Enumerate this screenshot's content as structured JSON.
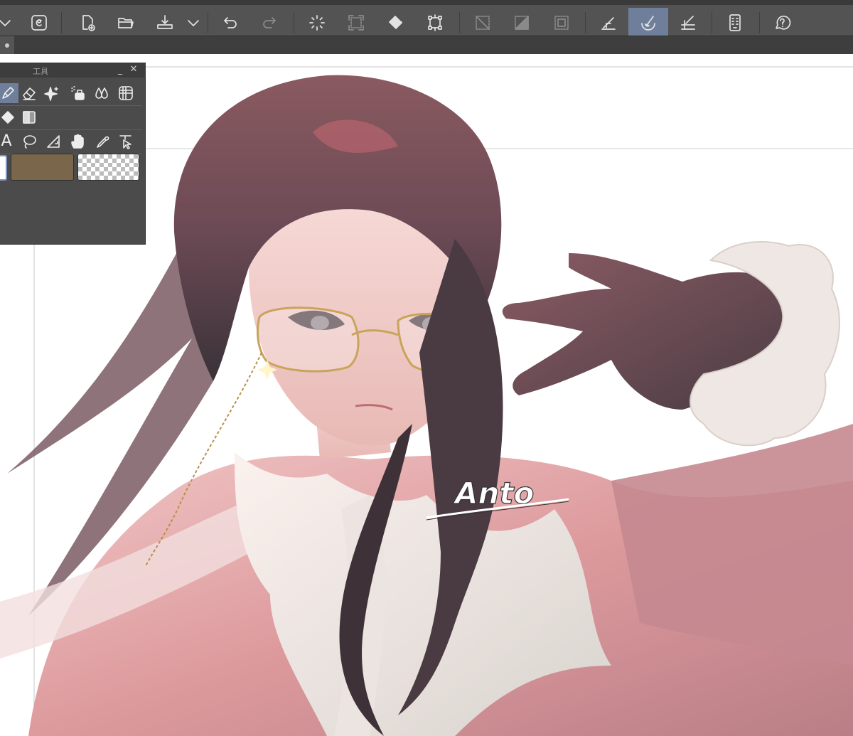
{
  "toolbar": {
    "buttons": [
      {
        "name": "menu-dropdown",
        "icon": "chevron-down-icon"
      },
      {
        "name": "app-menu",
        "icon": "clip-studio-icon"
      },
      {
        "name": "new-canvas",
        "icon": "new-document-icon"
      },
      {
        "name": "open-file",
        "icon": "folder-icon"
      },
      {
        "name": "save-file",
        "icon": "save-icon"
      },
      {
        "name": "save-options",
        "icon": "chevron-down-icon"
      },
      {
        "name": "undo",
        "icon": "undo-icon"
      },
      {
        "name": "redo",
        "icon": "redo-icon"
      },
      {
        "name": "loading-indicator",
        "icon": "spinner-icon"
      },
      {
        "name": "transform",
        "icon": "transform-icon"
      },
      {
        "name": "fill",
        "icon": "paint-bucket-icon"
      },
      {
        "name": "free-transform",
        "icon": "bounding-box-icon"
      },
      {
        "name": "clear-selection",
        "icon": "clear-selection-icon"
      },
      {
        "name": "invert-selection",
        "icon": "invert-selection-icon"
      },
      {
        "name": "show-selection",
        "icon": "selection-border-icon"
      },
      {
        "name": "snap-ruler",
        "icon": "snap-ruler-icon"
      },
      {
        "name": "snap-special-ruler",
        "icon": "brush-snap-icon"
      },
      {
        "name": "snap-grid",
        "icon": "snap-grid-icon"
      },
      {
        "name": "companion-mode",
        "icon": "tablet-icon"
      },
      {
        "name": "help",
        "icon": "help-icon"
      }
    ],
    "active_button": "snap-special-ruler"
  },
  "tab": {
    "icon": "dot-icon"
  },
  "palette": {
    "title": "工具",
    "minimize_glyph": "_",
    "close_glyph": "✕",
    "tools_row1": [
      "pen-icon",
      "eraser-icon",
      "decoration-sparkle-icon",
      "airbrush-icon",
      "blend-drops-icon",
      "frame-border-icon"
    ],
    "tools_row2": [
      "fill-bucket-icon",
      "gradient-icon"
    ],
    "tools_row3": [
      "text-icon",
      "lasso-icon",
      "ruler-icon",
      "hand-icon",
      "eyedropper-icon",
      "operation-icon"
    ],
    "text_tool_glyph": "A",
    "active_tool": "pen-icon",
    "main_color": "#ffffff",
    "sub_color": "#7a674b"
  },
  "artwork": {
    "signature": "Anto"
  }
}
